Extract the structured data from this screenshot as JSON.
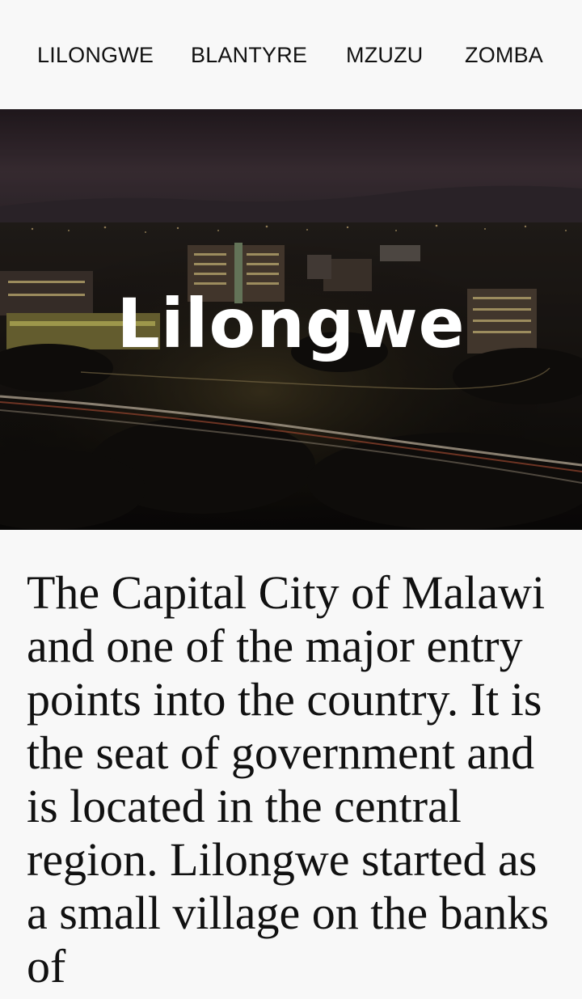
{
  "nav": {
    "items": [
      {
        "label": "LILONGWE"
      },
      {
        "label": "BLANTYRE"
      },
      {
        "label": "MZUZU"
      },
      {
        "label": "ZOMBA"
      }
    ]
  },
  "hero": {
    "title": "Lilongwe"
  },
  "content": {
    "paragraph": "The Capital City of Malawi and one of the major entry points into the country. It is the seat of government and is located in the central region. Lilongwe started as a small village on the banks of"
  }
}
